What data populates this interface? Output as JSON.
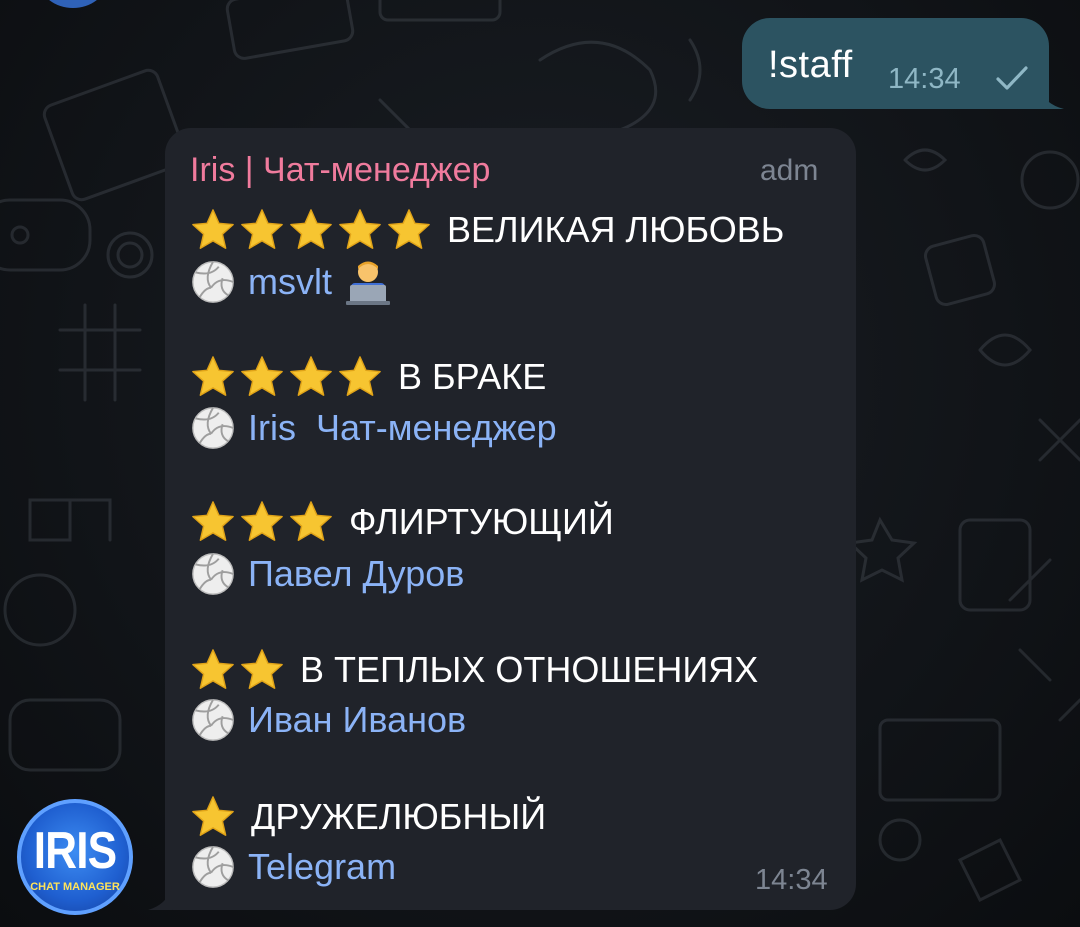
{
  "outgoing": {
    "text": "!staff",
    "time": "14:34",
    "status_icon": "check-icon"
  },
  "incoming": {
    "sender": "Iris | Чат-менеджер",
    "role_tag": "adm",
    "time": "14:34",
    "items": [
      {
        "stars": 5,
        "title": "ВЕЛИКАЯ ЛЮБОВЬ",
        "name": "msvlt",
        "extra_icon": "technologist-emoji-icon"
      },
      {
        "stars": 4,
        "title": "В БРАКЕ",
        "name": "Iris  Чат-менеджер"
      },
      {
        "stars": 3,
        "title": "ФЛИРТУЮЩИЙ",
        "name": "Павел Дуров"
      },
      {
        "stars": 2,
        "title": "В ТЕПЛЫХ ОТНОШЕНИЯХ",
        "name": "Иван Иванов"
      },
      {
        "stars": 1,
        "title": "ДРУЖЕЛЮБНЫЙ",
        "name": "Telegram"
      }
    ]
  },
  "bot_avatar": {
    "logo_text": "IRIS",
    "logo_subtext": "CHAT MANAGER"
  },
  "colors": {
    "sender_name": "#f07b9d",
    "mention_link": "#8bb3f6",
    "outgoing_bubble": "#2c5361",
    "incoming_bubble": "#20232a",
    "star": "#f7c531"
  }
}
